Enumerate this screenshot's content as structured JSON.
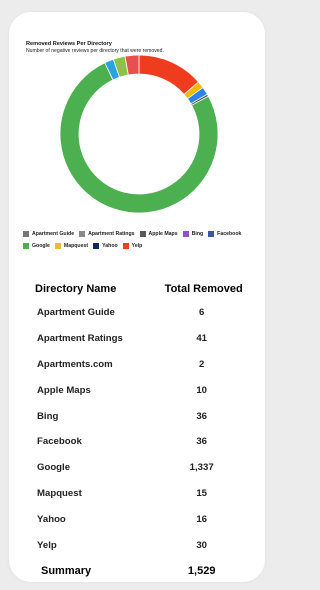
{
  "chart_data": {
    "type": "pie",
    "title": "Removed Reviews Per Directory",
    "subtitle": "Number of negative reviews per directory that were removed.",
    "categories": [
      "Apartment Guide",
      "Apartment Ratings",
      "Apartments.com",
      "Apple Maps",
      "Bing",
      "Facebook",
      "Google",
      "Mapquest",
      "Yahoo",
      "Yelp"
    ],
    "values": [
      6,
      41,
      2,
      10,
      36,
      36,
      1337,
      15,
      16,
      30
    ],
    "legend": [
      {
        "label": "Apartment Guide",
        "color": "#767676"
      },
      {
        "label": "Apartment Ratings",
        "color": "#8a8a8a"
      },
      {
        "label": "Apple Maps",
        "color": "#595959"
      },
      {
        "label": "Bing",
        "color": "#9b4fb8"
      },
      {
        "label": "Facebook",
        "color": "#3b5998"
      },
      {
        "label": "Google",
        "color": "#4caf50"
      },
      {
        "label": "Mapquest",
        "color": "#f0b73a"
      },
      {
        "label": "Yahoo",
        "color": "#0d2a5c"
      },
      {
        "label": "Yelp",
        "color": "#e8411c"
      }
    ],
    "slices": [
      {
        "name": "Yelp",
        "value": 420,
        "color": "#f03c1e"
      },
      {
        "name": "Mapquest",
        "value": 45,
        "color": "#f5b800"
      },
      {
        "name": "Bing",
        "value": 50,
        "color": "#2a84ea"
      },
      {
        "name": "Apple Maps",
        "value": 14,
        "color": "#4a4a4a"
      },
      {
        "name": "Google",
        "value": 2350,
        "color": "#4caf50"
      },
      {
        "name": "Apartments.com",
        "value": 58,
        "color": "#2ba3df"
      },
      {
        "name": "Apartment Ratings",
        "value": 75,
        "color": "#8bc34a"
      },
      {
        "name": "Apartment Guide",
        "value": 88,
        "color": "#e85050"
      }
    ]
  },
  "table": {
    "headers": [
      "Directory Name",
      "Total Removed"
    ],
    "rows": [
      [
        "Apartment Guide",
        "6"
      ],
      [
        "Apartment Ratings",
        "41"
      ],
      [
        "Apartments.com",
        "2"
      ],
      [
        "Apple Maps",
        "10"
      ],
      [
        "Bing",
        "36"
      ],
      [
        "Facebook",
        "36"
      ],
      [
        "Google",
        "1,337"
      ],
      [
        "Mapquest",
        "15"
      ],
      [
        "Yahoo",
        "16"
      ],
      [
        "Yelp",
        "30"
      ]
    ],
    "summary": [
      "Summary",
      "1,529"
    ]
  }
}
